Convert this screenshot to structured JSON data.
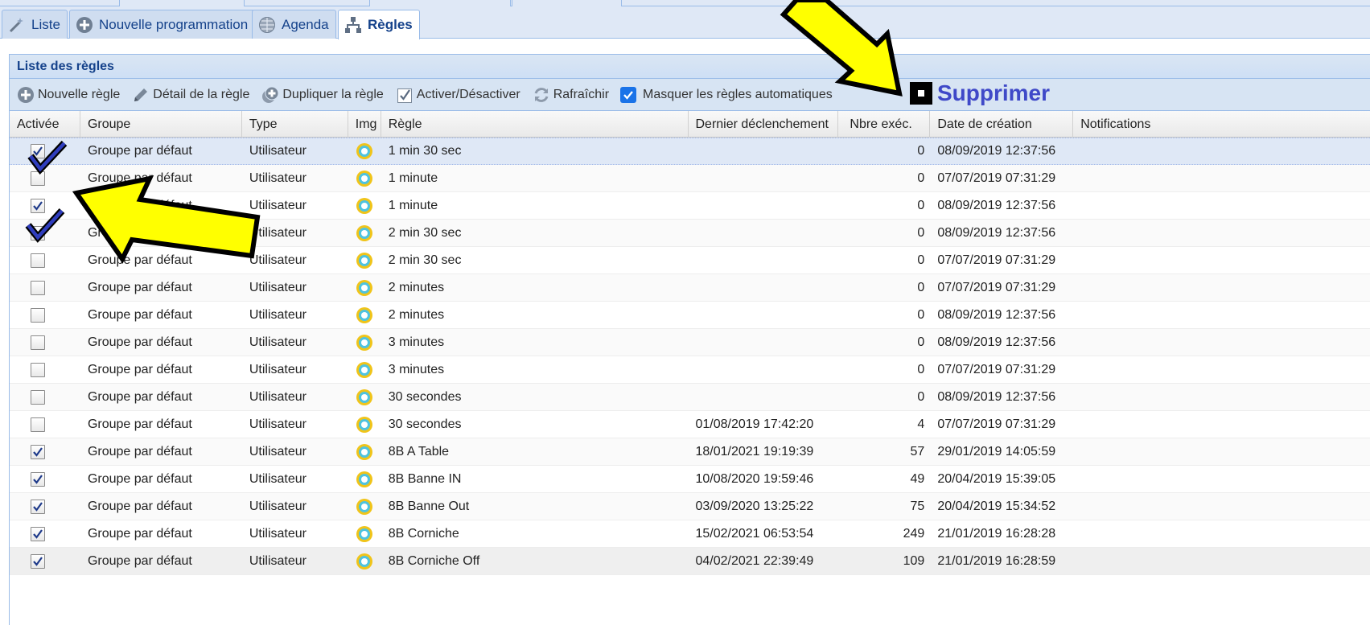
{
  "tabs": [
    {
      "label": "Liste",
      "icon": "magic-wand-icon",
      "active": false
    },
    {
      "label": "Nouvelle programmation",
      "icon": "plus-circle-icon",
      "active": false
    },
    {
      "label": "Agenda",
      "icon": "globe-icon",
      "active": false
    },
    {
      "label": "Règles",
      "icon": "hierarchy-icon",
      "active": true
    }
  ],
  "panel": {
    "title": "Liste des règles"
  },
  "toolbar": {
    "new_rule": "Nouvelle règle",
    "rule_detail": "Détail de la règle",
    "duplicate_rule": "Dupliquer la règle",
    "toggle": "Activer/Désactiver",
    "refresh": "Rafraîchir",
    "hide_auto": "Masquer les règles automatiques",
    "hide_auto_checked": true,
    "delete": "Supprimer"
  },
  "columns": [
    "Activée",
    "Groupe",
    "Type",
    "Img",
    "Règle",
    "Dernier déclenchement",
    "Nbre exéc.",
    "Date de création",
    "Notifications"
  ],
  "rows": [
    {
      "active": true,
      "group": "Groupe par défaut",
      "type": "Utilisateur",
      "rule": "1 min 30 sec",
      "last": "",
      "count": "0",
      "created": "08/09/2019 12:37:56",
      "notif": ""
    },
    {
      "active": false,
      "group": "Groupe par défaut",
      "type": "Utilisateur",
      "rule": "1 minute",
      "last": "",
      "count": "0",
      "created": "07/07/2019 07:31:29",
      "notif": ""
    },
    {
      "active": true,
      "group": "Groupe par défaut",
      "type": "Utilisateur",
      "rule": "1 minute",
      "last": "",
      "count": "0",
      "created": "08/09/2019 12:37:56",
      "notif": ""
    },
    {
      "active": false,
      "group": "Groupe par défaut",
      "type": "Utilisateur",
      "rule": "2 min 30 sec",
      "last": "",
      "count": "0",
      "created": "08/09/2019 12:37:56",
      "notif": ""
    },
    {
      "active": false,
      "group": "Groupe par défaut",
      "type": "Utilisateur",
      "rule": "2 min 30 sec",
      "last": "",
      "count": "0",
      "created": "07/07/2019 07:31:29",
      "notif": ""
    },
    {
      "active": false,
      "group": "Groupe par défaut",
      "type": "Utilisateur",
      "rule": "2 minutes",
      "last": "",
      "count": "0",
      "created": "07/07/2019 07:31:29",
      "notif": ""
    },
    {
      "active": false,
      "group": "Groupe par défaut",
      "type": "Utilisateur",
      "rule": "2 minutes",
      "last": "",
      "count": "0",
      "created": "08/09/2019 12:37:56",
      "notif": ""
    },
    {
      "active": false,
      "group": "Groupe par défaut",
      "type": "Utilisateur",
      "rule": "3 minutes",
      "last": "",
      "count": "0",
      "created": "08/09/2019 12:37:56",
      "notif": ""
    },
    {
      "active": false,
      "group": "Groupe par défaut",
      "type": "Utilisateur",
      "rule": "3 minutes",
      "last": "",
      "count": "0",
      "created": "07/07/2019 07:31:29",
      "notif": ""
    },
    {
      "active": false,
      "group": "Groupe par défaut",
      "type": "Utilisateur",
      "rule": "30 secondes",
      "last": "",
      "count": "0",
      "created": "08/09/2019 12:37:56",
      "notif": ""
    },
    {
      "active": false,
      "group": "Groupe par défaut",
      "type": "Utilisateur",
      "rule": "30 secondes",
      "last": "01/08/2019 17:42:20",
      "count": "4",
      "created": "07/07/2019 07:31:29",
      "notif": ""
    },
    {
      "active": true,
      "group": "Groupe par défaut",
      "type": "Utilisateur",
      "rule": "8B A Table",
      "last": "18/01/2021 19:19:39",
      "count": "57",
      "created": "29/01/2019 14:05:59",
      "notif": ""
    },
    {
      "active": true,
      "group": "Groupe par défaut",
      "type": "Utilisateur",
      "rule": "8B Banne IN",
      "last": "10/08/2020 19:59:46",
      "count": "49",
      "created": "20/04/2019 15:39:05",
      "notif": ""
    },
    {
      "active": true,
      "group": "Groupe par défaut",
      "type": "Utilisateur",
      "rule": "8B Banne Out",
      "last": "03/09/2020 13:25:22",
      "count": "75",
      "created": "20/04/2019 15:34:52",
      "notif": ""
    },
    {
      "active": true,
      "group": "Groupe par défaut",
      "type": "Utilisateur",
      "rule": "8B Corniche",
      "last": "15/02/2021 06:53:54",
      "count": "249",
      "created": "21/01/2019 16:28:28",
      "notif": ""
    },
    {
      "active": true,
      "group": "Groupe par défaut",
      "type": "Utilisateur",
      "rule": "8B Corniche Off",
      "last": "04/02/2021 22:39:49",
      "count": "109",
      "created": "21/01/2019 16:28:59",
      "notif": ""
    }
  ],
  "colors": {
    "accent": "#15428b",
    "delete_label": "#3f49c8",
    "annotation_arrow": "#ffff00",
    "annotation_check": "#2f3dbd"
  }
}
